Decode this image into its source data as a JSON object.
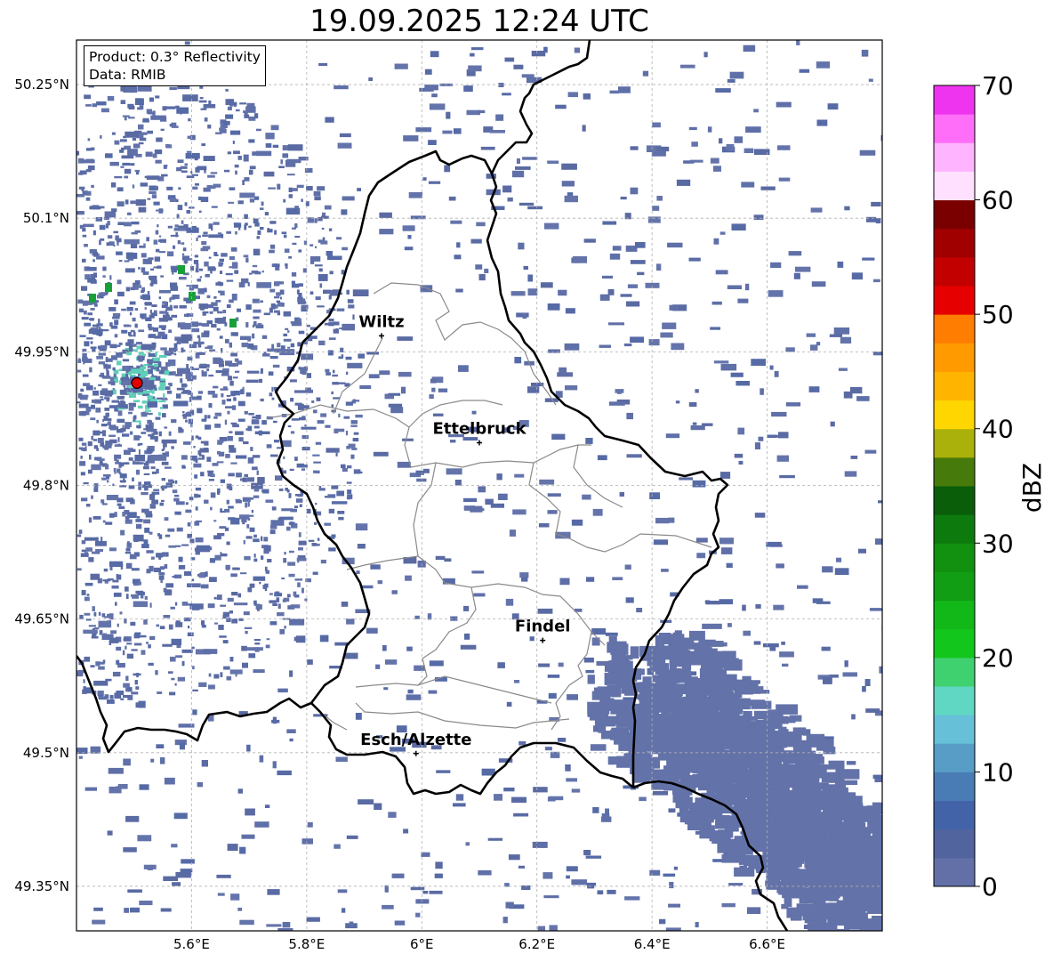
{
  "title": "19.09.2025 12:24 UTC",
  "info": {
    "product": "Product: 0.3° Reflectivity",
    "data": "Data: RMIB"
  },
  "map": {
    "lon_range": [
      5.4,
      6.8
    ],
    "lat_range": [
      49.3,
      50.3
    ],
    "lat_ticks": [
      {
        "value": 50.25,
        "label": "50.25°N"
      },
      {
        "value": 50.1,
        "label": "50.1°N"
      },
      {
        "value": 49.95,
        "label": "49.95°N"
      },
      {
        "value": 49.8,
        "label": "49.8°N"
      },
      {
        "value": 49.65,
        "label": "49.65°N"
      },
      {
        "value": 49.5,
        "label": "49.5°N"
      },
      {
        "value": 49.35,
        "label": "49.35°N"
      }
    ],
    "lon_ticks": [
      {
        "value": 5.6,
        "label": "5.6°E"
      },
      {
        "value": 5.8,
        "label": "5.8°E"
      },
      {
        "value": 6.0,
        "label": "6°E"
      },
      {
        "value": 6.2,
        "label": "6.2°E"
      },
      {
        "value": 6.4,
        "label": "6.4°E"
      },
      {
        "value": 6.6,
        "label": "6.6°E"
      }
    ],
    "cities": [
      {
        "name": "Wiltz",
        "lon": 5.93,
        "lat": 49.968
      },
      {
        "name": "Ettelbruck",
        "lon": 6.1,
        "lat": 49.848
      },
      {
        "name": "Findel",
        "lon": 6.21,
        "lat": 49.626
      },
      {
        "name": "Esch/Alzette",
        "lon": 5.99,
        "lat": 49.499
      }
    ],
    "radar_site": {
      "lon": 5.505,
      "lat": 49.915
    }
  },
  "colorbar": {
    "label": "dBZ",
    "min": 0,
    "max": 70,
    "ticks": [
      "0",
      "10",
      "20",
      "30",
      "40",
      "50",
      "60",
      "70"
    ],
    "colors": [
      "#6370a8",
      "#52649e",
      "#4263a8",
      "#497bb4",
      "#579dc6",
      "#66c0d8",
      "#60d7c2",
      "#3fd16f",
      "#12c61c",
      "#12b718",
      "#129e14",
      "#11910f",
      "#0d7a0d",
      "#0a5e0a",
      "#467a0a",
      "#aab10a",
      "#ffd600",
      "#ffb400",
      "#ff9a00",
      "#ff7d00",
      "#e60000",
      "#c30000",
      "#a00000",
      "#7a0000",
      "#ffe1ff",
      "#ffb4ff",
      "#ff6ef8",
      "#ee34ee"
    ]
  }
}
